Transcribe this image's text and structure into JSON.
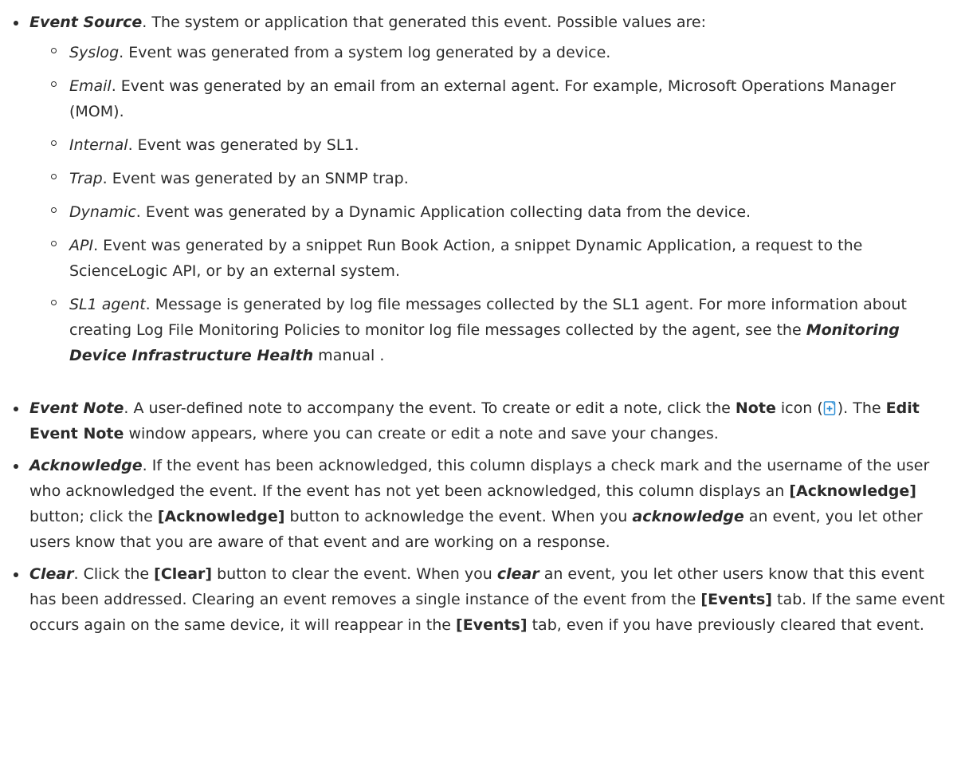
{
  "event_source": {
    "term": "Event Source",
    "intro": ". The system or application that generated this event. Possible values are:",
    "values": [
      {
        "name": "Syslog",
        "desc": ". Event was generated from a system log generated by a device."
      },
      {
        "name": "Email",
        "desc": ". Event was generated by an email from an external agent. For example, Microsoft Operations Manager (MOM)."
      },
      {
        "name": "Internal",
        "desc": ". Event was generated by SL1."
      },
      {
        "name": "Trap",
        "desc": ". Event was generated by an SNMP trap."
      },
      {
        "name": "Dynamic",
        "desc": ". Event was generated by a Dynamic Application collecting data from the device."
      },
      {
        "name": "API",
        "desc": ". Event was generated by a snippet Run Book Action, a snippet Dynamic Application, a request to the ScienceLogic API, or by an external system."
      }
    ],
    "agent": {
      "name": "SL1 agent",
      "desc": ". Message is generated by log file messages collected by the SL1 agent. For more information about creating Log File Monitoring Policies to monitor log file messages collected by the agent, see the ",
      "manual_title": "Monitoring Device Infrastructure Health",
      "manual_suffix": " manual ."
    }
  },
  "event_note": {
    "term": "Event Note",
    "text1": ". A user-defined note to accompany the event. To create or edit a note, click the ",
    "note_label": "Note",
    "text2": " icon (",
    "note_icon": "note-add-icon",
    "text3": "). The ",
    "window_label": "Edit Event Note",
    "text4": " window appears, where you can create or edit a note and save your changes."
  },
  "acknowledge": {
    "term": "Acknowledge",
    "text1": ". If the event has been acknowledged, this column displays a check mark and the username of the user who acknowledged the event. If the event has not yet been acknowledged, this column displays an ",
    "button1": "[Acknowledge]",
    "text2": " button; click the ",
    "button2": "[Acknowledge]",
    "text3": " button to acknowledge the event. When you ",
    "emph": "acknowledge",
    "text4": " an event, you let other users know that you are aware of that event and are working on a response."
  },
  "clear": {
    "term": "Clear",
    "text1": ". Click the ",
    "button": "[Clear]",
    "text2": " button to clear the event. When you ",
    "emph": "clear",
    "text3": " an event, you let other users know that this event has been addressed. Clearing an event removes a single instance of the event from the ",
    "tab1": "[Events]",
    "text4": " tab. If the same event occurs again on the same device, it will reappear in the ",
    "tab2": "[Events]",
    "text5": " tab, even if you have previously cleared that event."
  },
  "colors": {
    "text": "#2b2b2b",
    "icon_blue": "#2f8fd6"
  }
}
